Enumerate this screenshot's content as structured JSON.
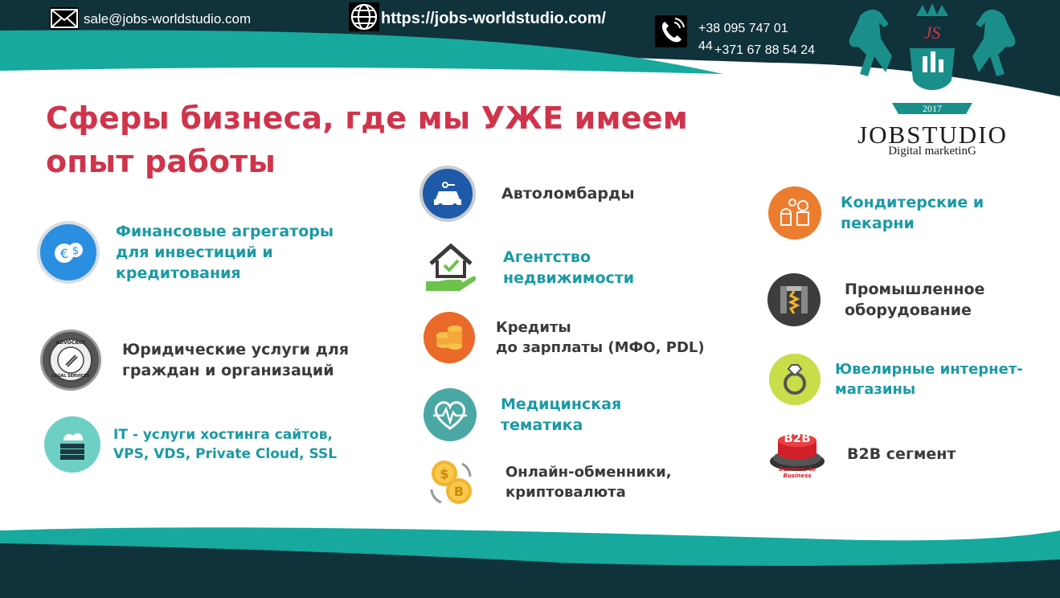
{
  "header": {
    "email": "sale@jobs-worldstudio.com",
    "url": "https://jobs-worldstudio.com/",
    "phone_1": "+38 095 747 01",
    "phone_1_cont": "44",
    "phone_2": "+371 67 88 54 24"
  },
  "logo": {
    "year": "2017",
    "monogram": "JS",
    "title": "JOBSTUDIO",
    "subtitle": "Digital marketinG"
  },
  "headline": {
    "line1": "Сферы бизнеса, где мы УЖЕ имеем",
    "line2": "опыт работы"
  },
  "column_left": [
    {
      "label_l1": "Финансовые агрегаторы",
      "label_l2": "для инвестиций и",
      "label_l3": "кредитования",
      "icon": "money-exchange-icon"
    },
    {
      "label_l1": "Юридические услуги для",
      "label_l2": "граждан и организаций",
      "icon": "legal-seal-icon",
      "seal_top": "ADVOCACY",
      "seal_bottom": "LEGAL SERVICES"
    },
    {
      "label_l1": "IT - услуги хостинга сайтов,",
      "label_l2": "VPS, VDS, Private Cloud, SSL",
      "icon": "cloud-server-icon"
    }
  ],
  "column_mid": [
    {
      "label_l1": "Автоломбарды",
      "icon": "car-key-icon"
    },
    {
      "label_l1": "Агентство",
      "label_l2": "недвижимости",
      "icon": "house-hand-icon"
    },
    {
      "label_l1": "Кредиты",
      "label_l2": "до зарплаты (МФО, PDL)",
      "icon": "coin-stacks-icon"
    },
    {
      "label_l1": "Медицинская",
      "label_l2": "тематика",
      "icon": "heart-pulse-icon"
    },
    {
      "label_l1": "Онлайн-обменники,",
      "label_l2": "криптовалюта",
      "icon": "crypto-coins-icon"
    }
  ],
  "column_right": [
    {
      "label_l1": "Кондитерские и",
      "label_l2": "пекарни",
      "icon": "bakery-icon"
    },
    {
      "label_l1": "Промышленное",
      "label_l2": "оборудование",
      "icon": "industrial-machine-icon"
    },
    {
      "label_l1": "Ювелирные интернет-",
      "label_l2": "магазины",
      "icon": "diamond-ring-icon"
    },
    {
      "label_l1": "B2B сегмент",
      "icon": "b2b-button-icon",
      "badge_top": "B2B",
      "badge_bottom": "Business to Business"
    }
  ],
  "colors": {
    "headline": "#d0344b",
    "teal_text": "#1a9aa4",
    "dark_band": "#10323a",
    "teal_band": "#17a99e"
  }
}
